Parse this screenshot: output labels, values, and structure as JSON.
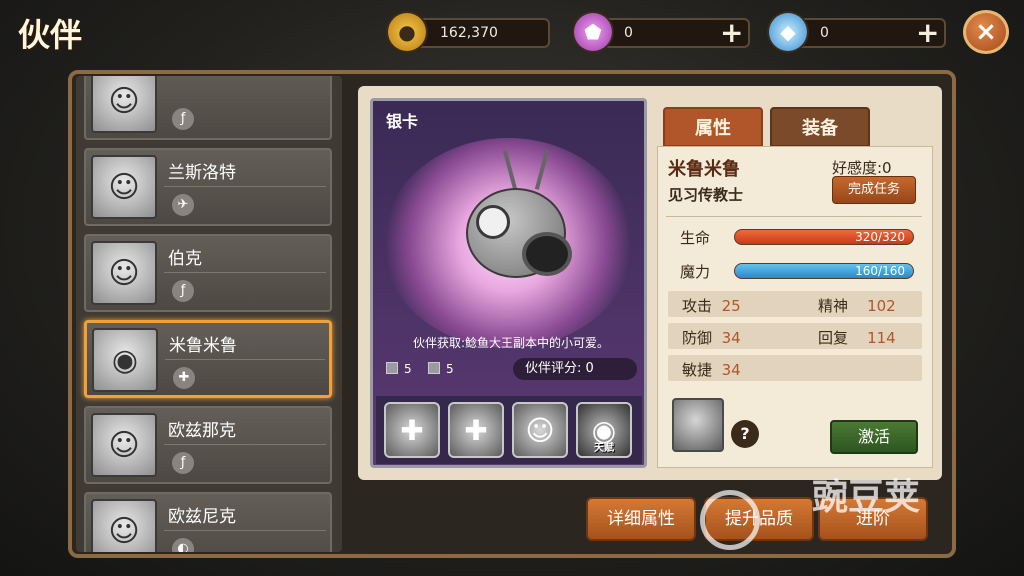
{
  "header": {
    "title": "伙伴",
    "gold": "162,370",
    "gem_purple": "0",
    "gem_blue": "0",
    "plus": "+",
    "close": "×"
  },
  "partners": [
    {
      "name": "",
      "role_icon": "ƒ"
    },
    {
      "name": "兰斯洛特",
      "role_icon": "✈"
    },
    {
      "name": "伯克",
      "role_icon": "ƒ"
    },
    {
      "name": "米鲁米鲁",
      "role_icon": "✚",
      "selected": true
    },
    {
      "name": "欧兹那克",
      "role_icon": "ƒ"
    },
    {
      "name": "欧兹尼克",
      "role_icon": "◐"
    }
  ],
  "card": {
    "rarity": "银卡",
    "description": "伙伴获取:鲶鱼大王副本中的小可爱。",
    "stat_a": "5",
    "stat_b": "5",
    "score_label": "伙伴评分: 0",
    "skills": [
      {
        "icon": "plus-cross-icon",
        "glyph": "✚"
      },
      {
        "icon": "double-plus-icon",
        "glyph": "✚"
      },
      {
        "icon": "person-glow-icon",
        "glyph": "☺"
      },
      {
        "icon": "eye-emblem-icon",
        "glyph": "◉",
        "tag": "天赋"
      }
    ]
  },
  "tabs": {
    "attributes": "属性",
    "equipment": "装备"
  },
  "info": {
    "name": "米鲁米鲁",
    "title": "见习传教士",
    "favor": "好感度:0",
    "quest_button": "完成任务",
    "hp_label": "生命",
    "hp_value": "320/320",
    "hp_fraction": 1.0,
    "mp_label": "魔力",
    "mp_value": "160/160",
    "mp_fraction": 1.0,
    "stats": {
      "attack_label": "攻击",
      "attack": "25",
      "spirit_label": "精神",
      "spirit": "102",
      "defense_label": "防御",
      "defense": "34",
      "recovery_label": "回复",
      "recovery": "114",
      "agility_label": "敏捷",
      "agility": "34"
    },
    "help": "?",
    "activate_button": "激活"
  },
  "bottom_buttons": {
    "detail": "详细属性",
    "upgrade": "提升品质",
    "advance": "进阶"
  },
  "watermark": "豌豆荚",
  "colors": {
    "accent_orange": "#b0562a",
    "hp_red": "#e0502a",
    "mp_blue": "#3a9ad8",
    "selected_border": "#f0a23a"
  }
}
